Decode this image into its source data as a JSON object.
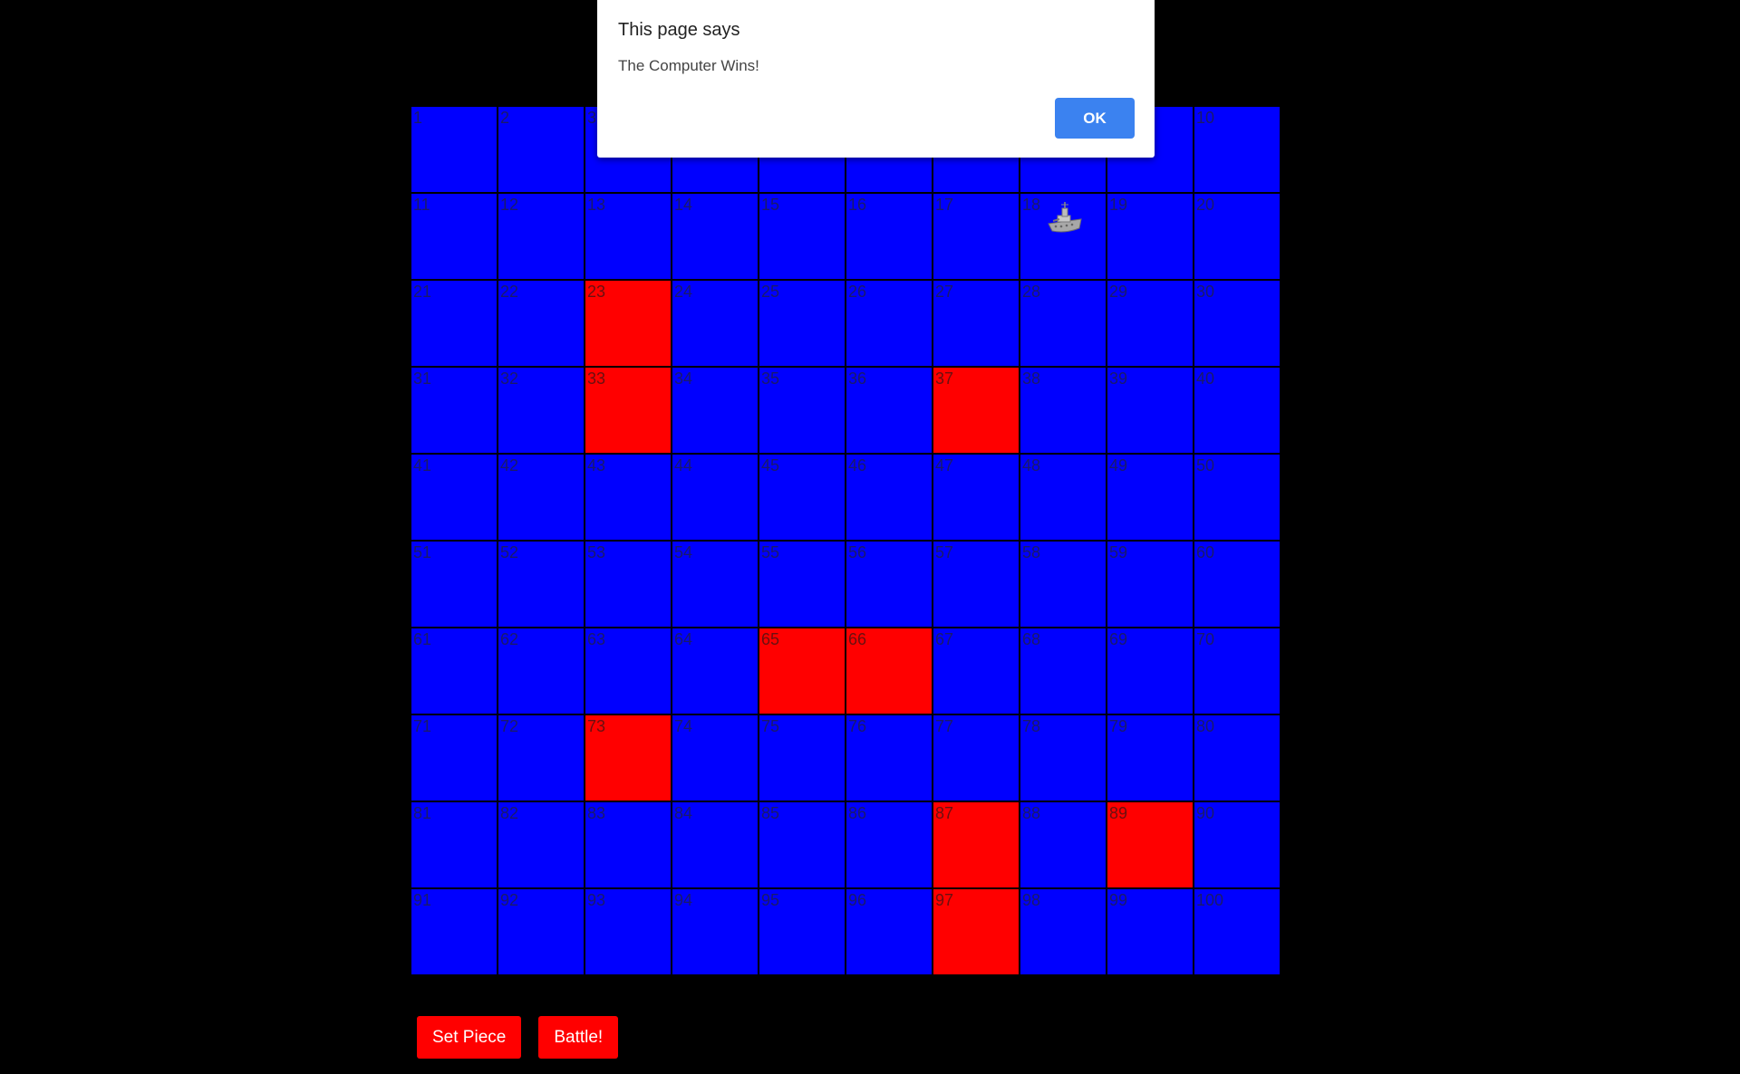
{
  "board": {
    "rows": 10,
    "cols": 10,
    "cell_color": "#0000ff",
    "hit_color": "#ff0000",
    "hit_cells": [
      23,
      33,
      37,
      65,
      66,
      73,
      87,
      89,
      97
    ],
    "ship_cell": 18,
    "ship_icon": "battleship-icon"
  },
  "controls": {
    "set_piece_label": "Set Piece",
    "battle_label": "Battle!"
  },
  "dialog": {
    "title": "This page says",
    "message": "The Computer Wins!",
    "ok_label": "OK"
  }
}
